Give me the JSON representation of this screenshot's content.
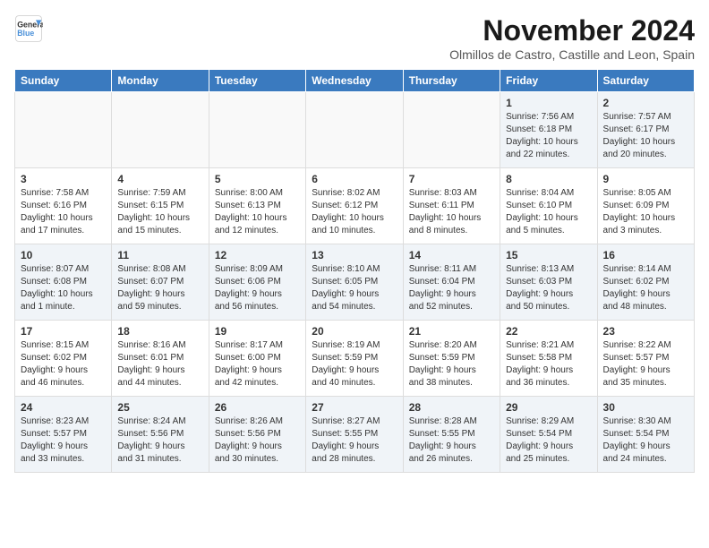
{
  "logo": {
    "line1": "General",
    "line2": "Blue"
  },
  "title": "November 2024",
  "subtitle": "Olmillos de Castro, Castille and Leon, Spain",
  "weekdays": [
    "Sunday",
    "Monday",
    "Tuesday",
    "Wednesday",
    "Thursday",
    "Friday",
    "Saturday"
  ],
  "weeks": [
    [
      {
        "day": "",
        "info": ""
      },
      {
        "day": "",
        "info": ""
      },
      {
        "day": "",
        "info": ""
      },
      {
        "day": "",
        "info": ""
      },
      {
        "day": "",
        "info": ""
      },
      {
        "day": "1",
        "info": "Sunrise: 7:56 AM\nSunset: 6:18 PM\nDaylight: 10 hours\nand 22 minutes."
      },
      {
        "day": "2",
        "info": "Sunrise: 7:57 AM\nSunset: 6:17 PM\nDaylight: 10 hours\nand 20 minutes."
      }
    ],
    [
      {
        "day": "3",
        "info": "Sunrise: 7:58 AM\nSunset: 6:16 PM\nDaylight: 10 hours\nand 17 minutes."
      },
      {
        "day": "4",
        "info": "Sunrise: 7:59 AM\nSunset: 6:15 PM\nDaylight: 10 hours\nand 15 minutes."
      },
      {
        "day": "5",
        "info": "Sunrise: 8:00 AM\nSunset: 6:13 PM\nDaylight: 10 hours\nand 12 minutes."
      },
      {
        "day": "6",
        "info": "Sunrise: 8:02 AM\nSunset: 6:12 PM\nDaylight: 10 hours\nand 10 minutes."
      },
      {
        "day": "7",
        "info": "Sunrise: 8:03 AM\nSunset: 6:11 PM\nDaylight: 10 hours\nand 8 minutes."
      },
      {
        "day": "8",
        "info": "Sunrise: 8:04 AM\nSunset: 6:10 PM\nDaylight: 10 hours\nand 5 minutes."
      },
      {
        "day": "9",
        "info": "Sunrise: 8:05 AM\nSunset: 6:09 PM\nDaylight: 10 hours\nand 3 minutes."
      }
    ],
    [
      {
        "day": "10",
        "info": "Sunrise: 8:07 AM\nSunset: 6:08 PM\nDaylight: 10 hours\nand 1 minute."
      },
      {
        "day": "11",
        "info": "Sunrise: 8:08 AM\nSunset: 6:07 PM\nDaylight: 9 hours\nand 59 minutes."
      },
      {
        "day": "12",
        "info": "Sunrise: 8:09 AM\nSunset: 6:06 PM\nDaylight: 9 hours\nand 56 minutes."
      },
      {
        "day": "13",
        "info": "Sunrise: 8:10 AM\nSunset: 6:05 PM\nDaylight: 9 hours\nand 54 minutes."
      },
      {
        "day": "14",
        "info": "Sunrise: 8:11 AM\nSunset: 6:04 PM\nDaylight: 9 hours\nand 52 minutes."
      },
      {
        "day": "15",
        "info": "Sunrise: 8:13 AM\nSunset: 6:03 PM\nDaylight: 9 hours\nand 50 minutes."
      },
      {
        "day": "16",
        "info": "Sunrise: 8:14 AM\nSunset: 6:02 PM\nDaylight: 9 hours\nand 48 minutes."
      }
    ],
    [
      {
        "day": "17",
        "info": "Sunrise: 8:15 AM\nSunset: 6:02 PM\nDaylight: 9 hours\nand 46 minutes."
      },
      {
        "day": "18",
        "info": "Sunrise: 8:16 AM\nSunset: 6:01 PM\nDaylight: 9 hours\nand 44 minutes."
      },
      {
        "day": "19",
        "info": "Sunrise: 8:17 AM\nSunset: 6:00 PM\nDaylight: 9 hours\nand 42 minutes."
      },
      {
        "day": "20",
        "info": "Sunrise: 8:19 AM\nSunset: 5:59 PM\nDaylight: 9 hours\nand 40 minutes."
      },
      {
        "day": "21",
        "info": "Sunrise: 8:20 AM\nSunset: 5:59 PM\nDaylight: 9 hours\nand 38 minutes."
      },
      {
        "day": "22",
        "info": "Sunrise: 8:21 AM\nSunset: 5:58 PM\nDaylight: 9 hours\nand 36 minutes."
      },
      {
        "day": "23",
        "info": "Sunrise: 8:22 AM\nSunset: 5:57 PM\nDaylight: 9 hours\nand 35 minutes."
      }
    ],
    [
      {
        "day": "24",
        "info": "Sunrise: 8:23 AM\nSunset: 5:57 PM\nDaylight: 9 hours\nand 33 minutes."
      },
      {
        "day": "25",
        "info": "Sunrise: 8:24 AM\nSunset: 5:56 PM\nDaylight: 9 hours\nand 31 minutes."
      },
      {
        "day": "26",
        "info": "Sunrise: 8:26 AM\nSunset: 5:56 PM\nDaylight: 9 hours\nand 30 minutes."
      },
      {
        "day": "27",
        "info": "Sunrise: 8:27 AM\nSunset: 5:55 PM\nDaylight: 9 hours\nand 28 minutes."
      },
      {
        "day": "28",
        "info": "Sunrise: 8:28 AM\nSunset: 5:55 PM\nDaylight: 9 hours\nand 26 minutes."
      },
      {
        "day": "29",
        "info": "Sunrise: 8:29 AM\nSunset: 5:54 PM\nDaylight: 9 hours\nand 25 minutes."
      },
      {
        "day": "30",
        "info": "Sunrise: 8:30 AM\nSunset: 5:54 PM\nDaylight: 9 hours\nand 24 minutes."
      }
    ]
  ]
}
